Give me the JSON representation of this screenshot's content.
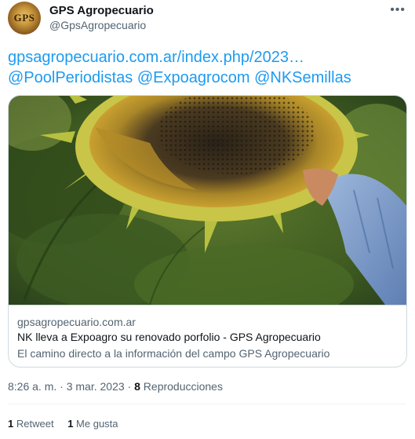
{
  "author": {
    "display_name": "GPS Agropecuario",
    "handle": "@GpsAgropecuario",
    "avatar_text": "GPS"
  },
  "tweet": {
    "link": "gpsagropecuario.com.ar/index.php/2023…",
    "mentions": "@PoolPeriodistas @Expoagrocom @NKSemillas"
  },
  "card": {
    "domain": "gpsagropecuario.com.ar",
    "title": "NK lleva a Expoagro su renovado porfolio - GPS Agropecuario",
    "description": "El camino directo a la información del campo GPS Agropecuario"
  },
  "meta": {
    "time": "8:26 a. m.",
    "separator": "·",
    "date": "3 mar. 2023",
    "views_count": "8",
    "views_label": "Reproducciones"
  },
  "stats": {
    "retweets_count": "1",
    "retweets_label": "Retweet",
    "likes_count": "1",
    "likes_label": "Me gusta"
  },
  "icons": {
    "more": "more-horizontal-icon"
  },
  "colors": {
    "link": "#1d9bf0",
    "secondary_text": "#536471",
    "border": "#cfd9de"
  }
}
